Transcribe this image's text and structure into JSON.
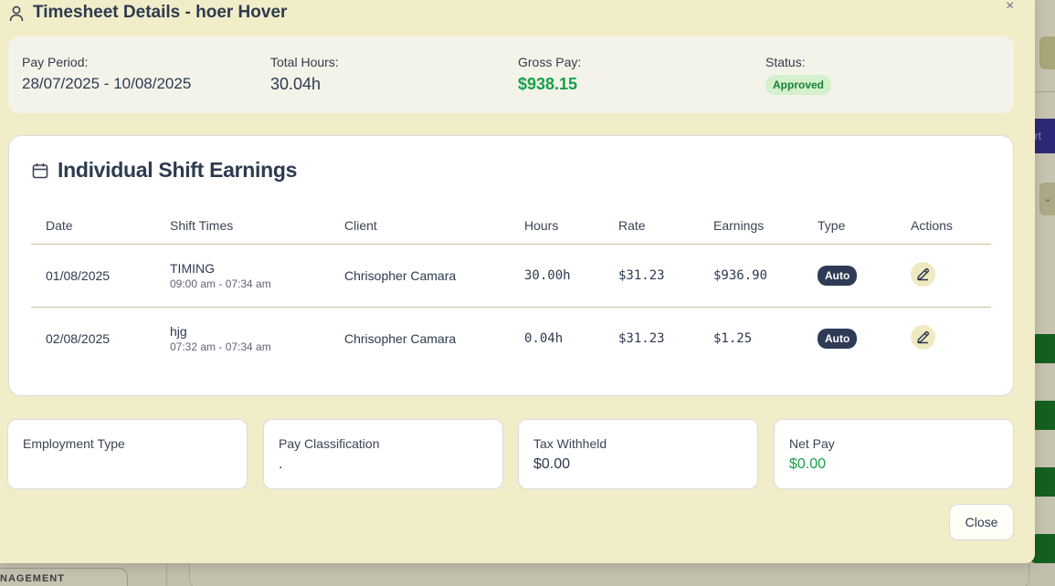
{
  "background": {
    "management_label": "NAGEMENT",
    "export_partial": "ort"
  },
  "modal": {
    "title": "Timesheet Details - hoer Hover",
    "close_glyph": "×",
    "summary": {
      "pay_period_label": "Pay Period:",
      "pay_period_value": "28/07/2025 - 10/08/2025",
      "total_hours_label": "Total Hours:",
      "total_hours_value": "30.04h",
      "gross_pay_label": "Gross Pay:",
      "gross_pay_value": "$938.15",
      "status_label": "Status:",
      "status_value": "Approved"
    },
    "shifts": {
      "title": "Individual Shift Earnings",
      "columns": [
        "Date",
        "Shift Times",
        "Client",
        "Hours",
        "Rate",
        "Earnings",
        "Type",
        "Actions"
      ],
      "rows": [
        {
          "date": "01/08/2025",
          "shift_name": "TIMING",
          "shift_time": "09:00 am - 07:34 am",
          "client": "Chrisopher Camara",
          "hours": "30.00h",
          "rate": "$31.23",
          "earnings": "$936.90",
          "type": "Auto"
        },
        {
          "date": "02/08/2025",
          "shift_name": "hjg",
          "shift_time": "07:32 am - 07:34 am",
          "client": "Chrisopher Camara",
          "hours": "0.04h",
          "rate": "$31.23",
          "earnings": "$1.25",
          "type": "Auto"
        }
      ]
    },
    "info_cards": [
      {
        "label": "Employment Type",
        "value": ""
      },
      {
        "label": "Pay Classification",
        "value": "."
      },
      {
        "label": "Tax Withheld",
        "value": "$0.00"
      },
      {
        "label": "Net Pay",
        "value": "$0.00"
      }
    ],
    "close_button": "Close"
  },
  "colors": {
    "modal_bg": "#f0edc8",
    "accent_green": "#18a04a",
    "badge_navy": "#2e3a56",
    "approved_bg": "#d4f0cc"
  },
  "icons": {
    "title": "user-icon",
    "shifts": "calendar-icon",
    "edit": "pencil-icon",
    "close": "close-icon"
  }
}
